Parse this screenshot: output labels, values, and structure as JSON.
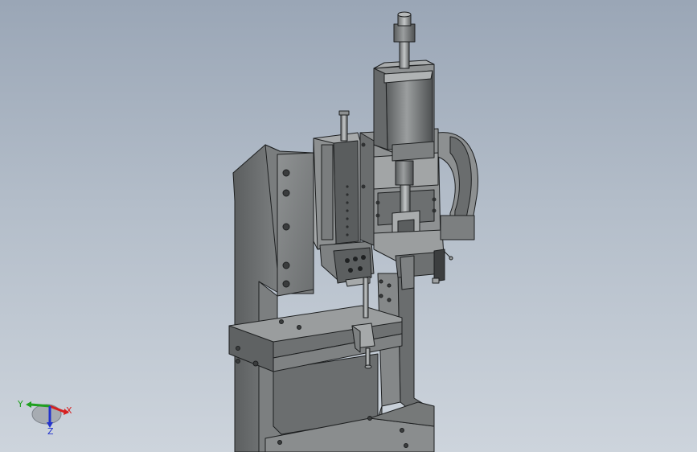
{
  "viewport": {
    "background_top": "#9aa6b6",
    "background_bottom": "#cdd4dc"
  },
  "model": {
    "body_color": "#6f7273",
    "face_light": "#8c8f90",
    "face_dark": "#4d5051",
    "edge_color": "#1d1f20"
  },
  "triad": {
    "x_label": "X",
    "y_label": "Y",
    "z_label": "Z",
    "x_color": "#d62020",
    "y_color": "#1fa01f",
    "z_color": "#2233cc"
  }
}
